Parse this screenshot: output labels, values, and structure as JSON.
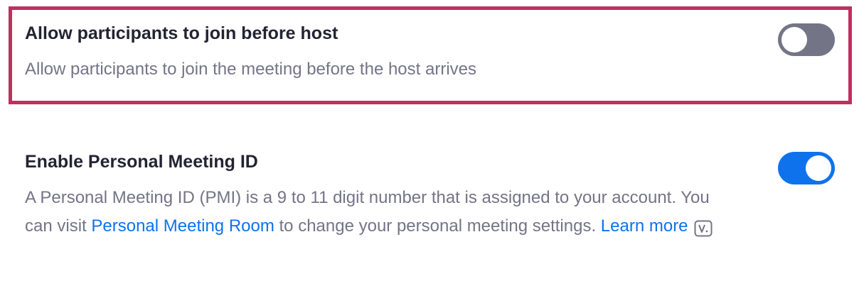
{
  "settings": [
    {
      "title": "Allow participants to join before host",
      "description": "Allow participants to join the meeting before the host arrives",
      "enabled": false,
      "highlighted": true
    },
    {
      "title": "Enable Personal Meeting ID",
      "description_part1": "A Personal Meeting ID (PMI) is a 9 to 11 digit number that is assigned to your account. You can visit ",
      "link_label": "Personal Meeting Room",
      "description_part2": " to change your personal meeting settings. ",
      "learn_more_label": "Learn more",
      "learn_more_icon": "video-icon",
      "enabled": true,
      "highlighted": false
    }
  ],
  "colors": {
    "highlight_border": "#c0305f",
    "toggle_on": "#0e72ed",
    "toggle_off": "#747487",
    "link": "#0e72ed",
    "title_text": "#232333",
    "description_text": "#747487"
  }
}
